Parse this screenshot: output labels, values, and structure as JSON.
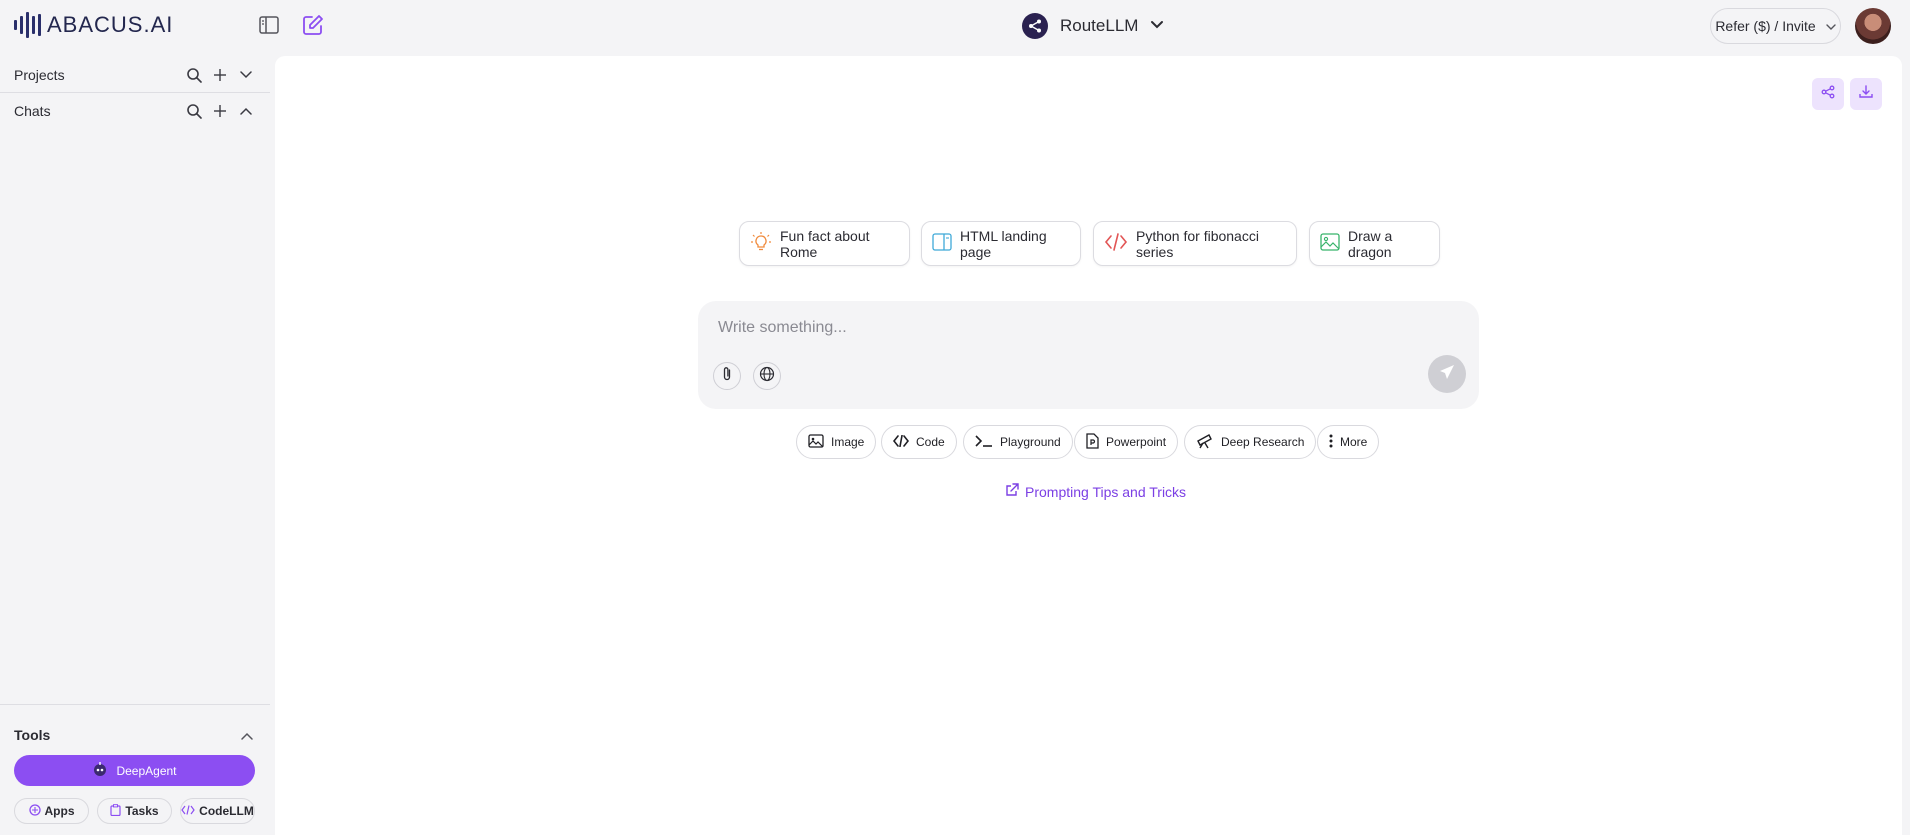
{
  "header": {
    "logo_text": "ABACUS.AI",
    "model_name": "RouteLLM",
    "refer_label": "Refer ($) / Invite"
  },
  "sidebar": {
    "projects_label": "Projects",
    "chats_label": "Chats",
    "tools_label": "Tools",
    "deepagent_label": "DeepAgent",
    "tool_links": [
      "Apps",
      "Tasks",
      "CodeLLM"
    ]
  },
  "main": {
    "suggestions": [
      "Fun fact about Rome",
      "HTML landing page",
      "Python for fibonacci series",
      "Draw a dragon"
    ],
    "composer_placeholder": "Write something...",
    "modes": [
      "Image",
      "Code",
      "Playground",
      "Powerpoint",
      "Deep Research",
      "More"
    ],
    "tips_label": "Prompting Tips and Tricks"
  },
  "colors": {
    "accent": "#8c4ef2",
    "accent_text": "#7b3fe4",
    "background": "#f4f4f6",
    "panel": "#ffffff"
  }
}
